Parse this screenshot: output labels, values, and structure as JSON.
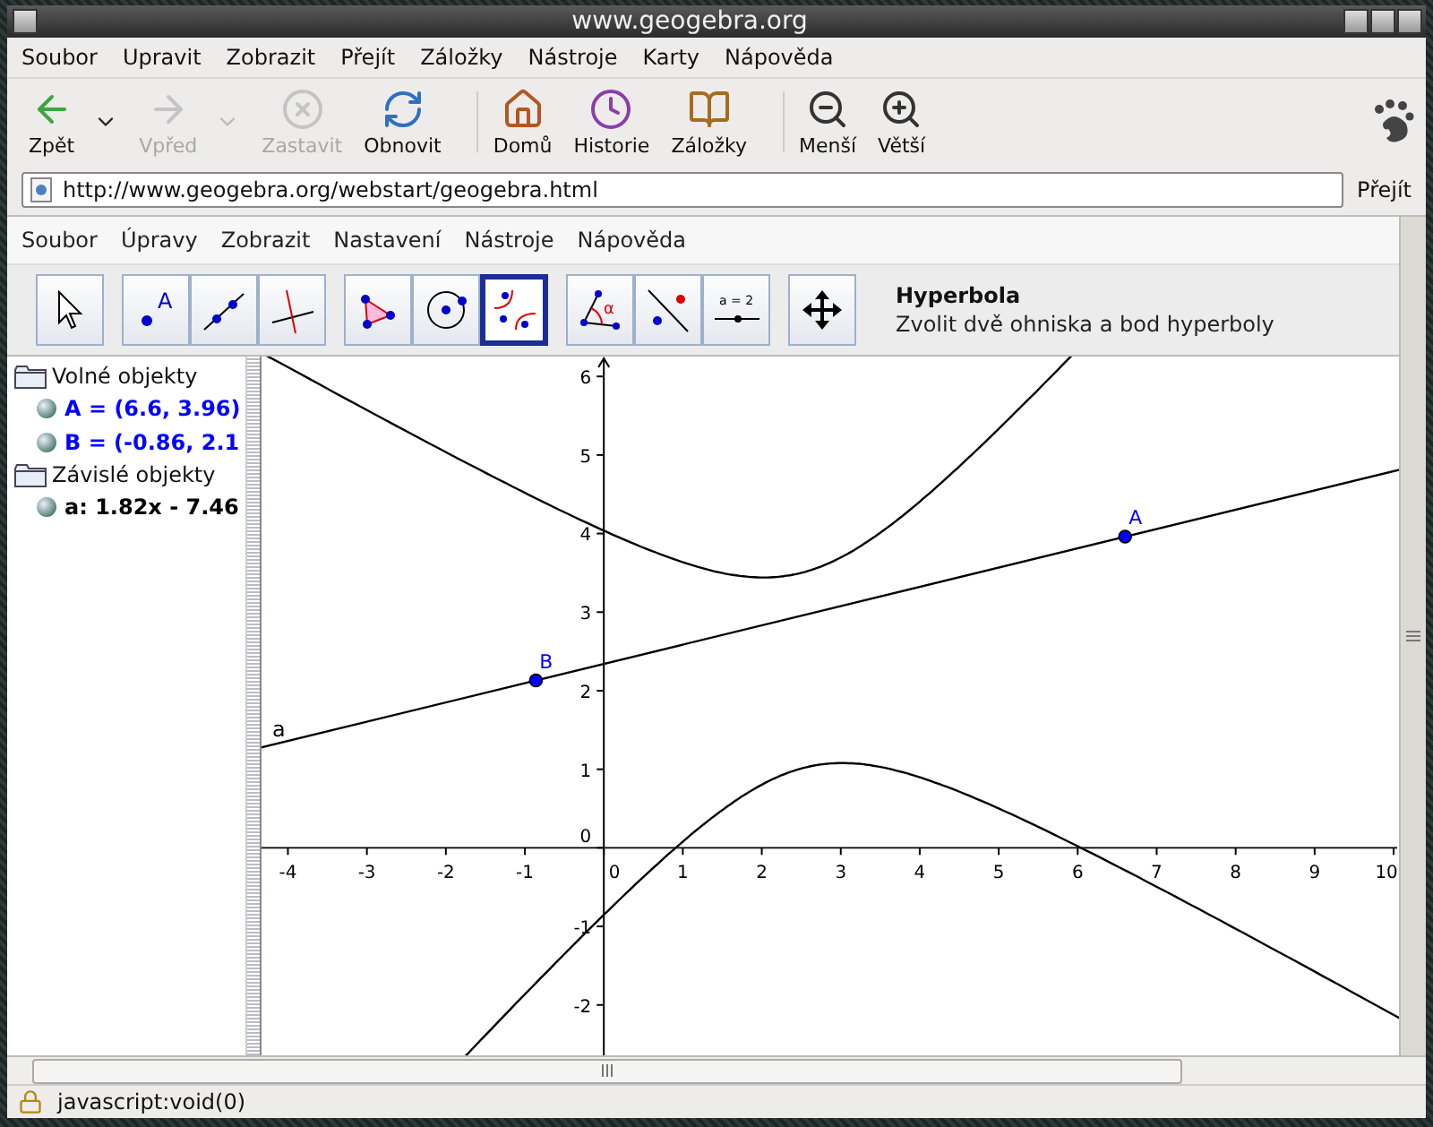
{
  "window": {
    "title": "www.geogebra.org"
  },
  "menu": [
    "Soubor",
    "Upravit",
    "Zobrazit",
    "Přejít",
    "Záložky",
    "Nástroje",
    "Karty",
    "Nápověda"
  ],
  "toolbar": [
    {
      "kind": "back",
      "label": "Zpět",
      "disabled": false,
      "dropdown": true,
      "separator_before": false
    },
    {
      "kind": "forward",
      "label": "Vpřed",
      "disabled": true,
      "dropdown": true,
      "separator_before": false
    },
    {
      "kind": "stop",
      "label": "Zastavit",
      "disabled": true,
      "dropdown": false,
      "separator_before": false
    },
    {
      "kind": "reload",
      "label": "Obnovit",
      "disabled": false,
      "dropdown": false,
      "separator_before": false
    },
    {
      "kind": "home",
      "label": "Domů",
      "disabled": false,
      "dropdown": false,
      "separator_before": true
    },
    {
      "kind": "history",
      "label": "Historie",
      "disabled": false,
      "dropdown": false,
      "separator_before": false
    },
    {
      "kind": "bookmarks",
      "label": "Záložky",
      "disabled": false,
      "dropdown": false,
      "separator_before": false
    },
    {
      "kind": "zoom_out",
      "label": "Menší",
      "disabled": false,
      "dropdown": false,
      "separator_before": true
    },
    {
      "kind": "zoom_in",
      "label": "Větší",
      "disabled": false,
      "dropdown": false,
      "separator_before": false
    }
  ],
  "address": {
    "url": "http://www.geogebra.org/webstart/geogebra.html",
    "go": "Přejít"
  },
  "applet": {
    "menu": [
      "Soubor",
      "Úpravy",
      "Zobrazit",
      "Nastavení",
      "Nástroje",
      "Nápověda"
    ],
    "tools": [
      {
        "kind": "move",
        "selected": false,
        "group_start": false
      },
      {
        "kind": "point",
        "selected": false,
        "group_start": true,
        "glyph": "A"
      },
      {
        "kind": "line",
        "selected": false,
        "group_start": false
      },
      {
        "kind": "perpendicular",
        "selected": false,
        "group_start": false
      },
      {
        "kind": "polygon",
        "selected": false,
        "group_start": true
      },
      {
        "kind": "circle",
        "selected": false,
        "group_start": false
      },
      {
        "kind": "conic",
        "selected": true,
        "group_start": false
      },
      {
        "kind": "angle",
        "selected": false,
        "group_start": true,
        "glyph": "α"
      },
      {
        "kind": "reflect",
        "selected": false,
        "group_start": false
      },
      {
        "kind": "slider",
        "selected": false,
        "group_start": false,
        "glyph": "a = 2"
      },
      {
        "kind": "move_view",
        "selected": false,
        "group_start": true
      }
    ],
    "tool_info": {
      "title": "Hyperbola",
      "description": "Zvolit dvě ohniska a bod hyperboly"
    },
    "algebra": [
      {
        "label": "Volné objekty",
        "children": [
          {
            "text": "A = (6.6, 3.96)",
            "color": "#0000ff"
          },
          {
            "text": "B = (-0.86, 2.1",
            "color": "#0000ff"
          }
        ]
      },
      {
        "label": "Závislé objekty",
        "children": [
          {
            "text": "a: 1.82x - 7.46",
            "color": "#000000"
          }
        ]
      }
    ],
    "graphics": {
      "x_ticks": [
        "-4",
        "-3",
        "-2",
        "-1",
        "0",
        "1",
        "2",
        "3",
        "4",
        "5",
        "6",
        "7",
        "8",
        "9",
        "10"
      ],
      "y_ticks": [
        "6",
        "5",
        "4",
        "3",
        "2",
        "1",
        "0",
        "-1",
        "-2"
      ],
      "points": [
        {
          "label": "A"
        },
        {
          "label": "B"
        }
      ],
      "line_label": "a"
    }
  },
  "status_bar": {
    "text": "javascript:void(0)"
  }
}
